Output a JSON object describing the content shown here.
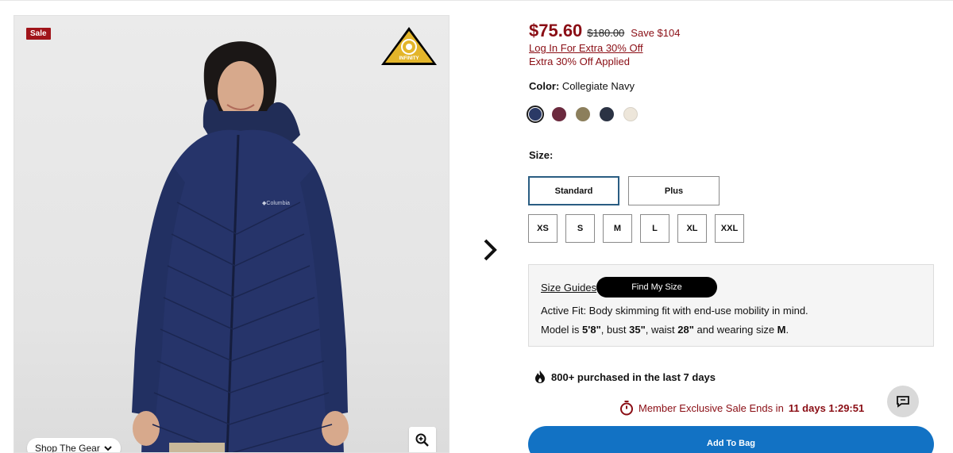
{
  "gallery": {
    "sale_badge": "Sale",
    "tech_badge_text": "OMNI-HEAT INFINITY",
    "shop_gear_label": "Shop The Gear"
  },
  "product": {
    "price_sale": "$75.60",
    "price_original": "$180.00",
    "price_save": "Save $104",
    "login_link": "Log In For Extra 30% Off",
    "extra_applied": "Extra 30% Off Applied",
    "color_label": "Color:",
    "color_value": "Collegiate Navy",
    "swatches": [
      {
        "name": "Collegiate Navy",
        "color": "#2b3a66",
        "selected": true
      },
      {
        "name": "Burgundy",
        "color": "#6b2a3e",
        "selected": false
      },
      {
        "name": "Olive",
        "color": "#8c7f5c",
        "selected": false
      },
      {
        "name": "Dark Navy",
        "color": "#2b3344",
        "selected": false
      },
      {
        "name": "Cream",
        "color": "#ede6da",
        "selected": false
      }
    ],
    "size_label": "Size:",
    "fits": [
      "Standard",
      "Plus"
    ],
    "sizes": [
      "XS",
      "S",
      "M",
      "L",
      "XL",
      "XXL"
    ]
  },
  "fit_info": {
    "size_guides": "Size Guides",
    "find_my_size": "Find My Size",
    "active_fit": "Active Fit: Body skimming fit with end-use mobility in mind.",
    "model_prefix": "Model is ",
    "height": "5'8\"",
    "bust_prefix": ", bust ",
    "bust": "35\"",
    "waist_prefix": ", waist ",
    "waist": "28\"",
    "size_prefix": " and wearing size ",
    "size": "M",
    "suffix": "."
  },
  "social": {
    "purchased_text": "800+ purchased in the last 7 days"
  },
  "promo": {
    "member_text": "Member Exclusive Sale Ends in",
    "countdown": "11 days 1:29:51"
  },
  "cta": {
    "add_to_bag": "Add To Bag"
  },
  "colors": {
    "sale_red": "#8a0d14",
    "primary_blue": "#1272c4",
    "selected_outline": "#2a5d82"
  }
}
